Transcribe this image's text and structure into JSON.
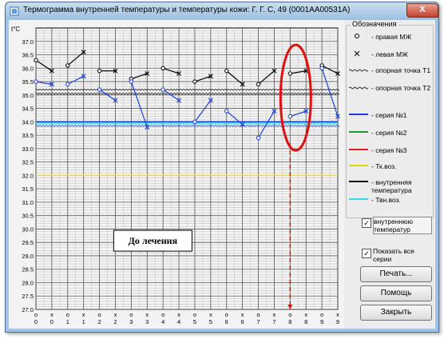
{
  "window": {
    "title": "Термограмма внутренней температуры и температуры кожи: Г. Г. С, 49 (0001АА00531А)",
    "close_glyph": "X"
  },
  "chart_data": {
    "type": "line",
    "ylabel": "t°C",
    "ylim": [
      27.0,
      37.5
    ],
    "yticks": [
      "37.0",
      "36.5",
      "36.0",
      "35.5",
      "35.0",
      "34.5",
      "34.0",
      "33.5",
      "33.0",
      "32.5",
      "32.0",
      "31.5",
      "31.0",
      "30.5",
      "30.0",
      "29.5",
      "29.0",
      "28.5",
      "28.0",
      "27.5",
      "27.0"
    ],
    "x_symbols": [
      "o",
      "x",
      "o",
      "x",
      "o",
      "x",
      "o",
      "x",
      "o",
      "x",
      "o",
      "x",
      "o",
      "x",
      "o",
      "x",
      "o",
      "x",
      "o",
      "x"
    ],
    "x_labels": [
      "0",
      "0",
      "1",
      "1",
      "2",
      "2",
      "3",
      "3",
      "4",
      "4",
      "5",
      "5",
      "6",
      "6",
      "7",
      "7",
      "8",
      "8",
      "9",
      "9"
    ],
    "series": [
      {
        "name": "внутренняя температура",
        "color": "#000000",
        "segments": [
          [
            [
              0,
              36.3
            ],
            [
              1,
              35.9
            ]
          ],
          [
            [
              2,
              36.1
            ],
            [
              3,
              36.6
            ]
          ],
          [
            [
              4,
              35.9
            ],
            [
              5,
              35.9
            ]
          ],
          [
            [
              6,
              35.6
            ],
            [
              7,
              35.8
            ]
          ],
          [
            [
              8,
              36.0
            ],
            [
              9,
              35.8
            ]
          ],
          [
            [
              10,
              35.5
            ],
            [
              11,
              35.7
            ]
          ],
          [
            [
              12,
              35.9
            ],
            [
              13,
              35.4
            ]
          ],
          [
            [
              14,
              35.4
            ],
            [
              15,
              35.9
            ]
          ],
          [
            [
              16,
              35.8
            ],
            [
              17,
              35.9
            ]
          ],
          [
            [
              18,
              36.1
            ],
            [
              19,
              35.8
            ]
          ]
        ]
      },
      {
        "name": "серия №1",
        "color": "#1a3fe0",
        "segments": [
          [
            [
              0,
              35.5
            ],
            [
              1,
              35.4
            ]
          ],
          [
            [
              2,
              35.4
            ],
            [
              3,
              35.7
            ]
          ],
          [
            [
              4,
              35.2
            ],
            [
              5,
              34.8
            ]
          ],
          [
            [
              6,
              35.5
            ],
            [
              7,
              33.8
            ]
          ],
          [
            [
              8,
              35.2
            ],
            [
              9,
              34.8
            ]
          ],
          [
            [
              10,
              34.0
            ],
            [
              11,
              34.8
            ]
          ],
          [
            [
              12,
              34.4
            ],
            [
              13,
              33.9
            ]
          ],
          [
            [
              14,
              33.4
            ],
            [
              15,
              34.4
            ]
          ],
          [
            [
              16,
              34.2
            ],
            [
              17,
              34.4
            ]
          ],
          [
            [
              18,
              36.0
            ],
            [
              19,
              34.2
            ]
          ]
        ]
      },
      {
        "name": "Твн.воз.",
        "color": "#33dddd",
        "values": [
          33.95
        ]
      },
      {
        "name": "серия №1 (ref)",
        "color": "#1a3fe0",
        "values": [
          34.0
        ]
      },
      {
        "name": "Тк.воз.",
        "color": "#e8e800",
        "values": [
          32.0
        ]
      }
    ],
    "reference_T1": 35.2,
    "reference_T2": 35.05,
    "reference_T2b": 33.85,
    "annotation": "До лечения",
    "highlight_index": 16
  },
  "legend": {
    "title": "Обозначения",
    "items": [
      {
        "label": "- правая МЖ",
        "icon": "circle-marker"
      },
      {
        "label": "- левая МЖ",
        "icon": "cross-marker"
      },
      {
        "label": "- опорная точка T1",
        "icon": "wavy-line"
      },
      {
        "label": "- опорная точка T2",
        "icon": "wavy-line"
      },
      {
        "label": "- серия №1",
        "icon": "line",
        "color": "#1a3fe0"
      },
      {
        "label": "- серия №2",
        "icon": "line",
        "color": "#1c9a2c"
      },
      {
        "label": "- серия №3",
        "icon": "line",
        "color": "#e02020"
      },
      {
        "label": "- Тк.воз.",
        "icon": "line",
        "color": "#e8d400"
      },
      {
        "label": "- внутренняя температура",
        "icon": "line",
        "color": "#000000"
      },
      {
        "label": "- Твн.воз.",
        "icon": "line",
        "color": "#33dddd"
      }
    ]
  },
  "controls": {
    "checkbox_internal_label": "внутреннюю температур",
    "checkbox_all_label": "Показать все серии",
    "checkbox_mark": "✓",
    "print_label": "Печать...",
    "help_label": "Помощь",
    "close_label": "Закрыть"
  }
}
